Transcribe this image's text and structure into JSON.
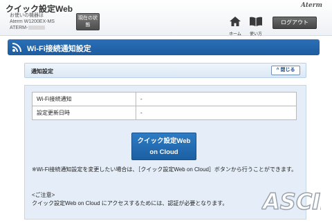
{
  "header": {
    "app_title": "クイック設定Web",
    "device_line1": "お使いの機器は",
    "device_line2": "Aterm W1200EX-MS",
    "device_line3": "ATERM-",
    "status_button": "現在の状態",
    "brand": "Aterm",
    "home_label": "ホーム",
    "manual_label": "使い方",
    "logout_label": "ログアウト"
  },
  "page": {
    "title": "Wi-Fi接続通知設定",
    "section_title": "通知設定",
    "collapse_label": "閉じる"
  },
  "table": {
    "rows": [
      {
        "label": "Wi-Fi接続通知",
        "value": "-"
      },
      {
        "label": "設定更新日時",
        "value": "-"
      }
    ]
  },
  "cloud_button": {
    "line1": "クイック設定Web",
    "line2": "on Cloud"
  },
  "notes": {
    "note1": "※Wi-Fi接続通知設定を変更したい場合は、［クイック設定Web on Cloud］ボタンから行うことができます。",
    "caution_heading": "<ご注意>",
    "caution_text": "クイック設定Web on Cloud にアクセスするためには、認証が必要となります。"
  },
  "watermark": "ASCII",
  "colors": {
    "title_bar": "#1d5c9e",
    "button_blue": "#1c5fa3",
    "panel_bg": "#e5eef8"
  }
}
